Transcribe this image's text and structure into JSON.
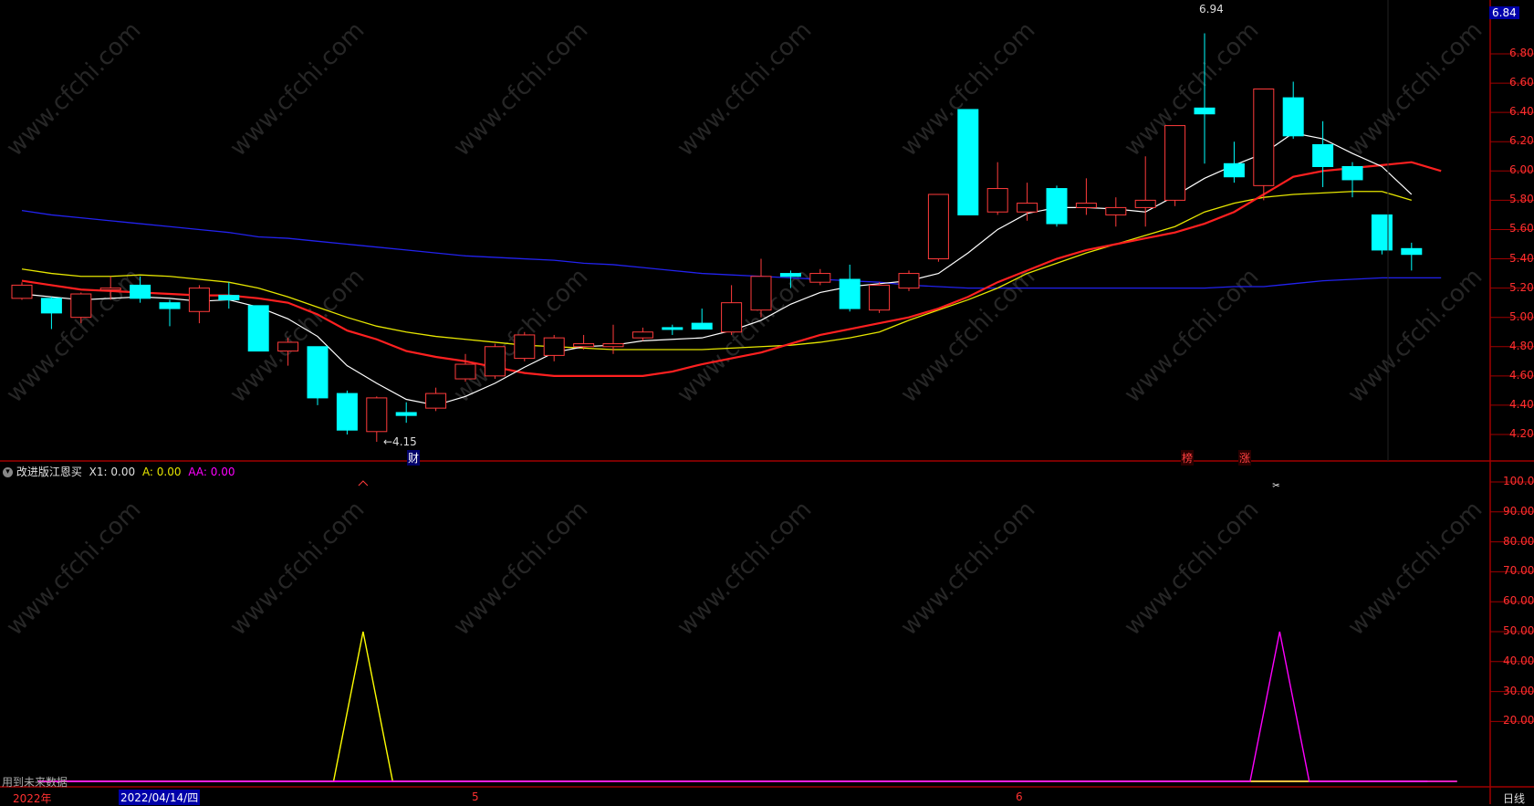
{
  "colors": {
    "up": "#ff3b3b",
    "down": "#00ffff",
    "ma5": "#ffffff",
    "ma10": "#ff2020",
    "ma20": "#e6e600",
    "ma60": "#2222ee",
    "axis": "#a00000",
    "grid": "#5a0000",
    "ind_x1": "#ffff00",
    "ind_aa": "#ff00ff",
    "price_box": "#0000aa"
  },
  "price_axis": {
    "current_price": "6.84",
    "ticks": [
      "6.80",
      "6.60",
      "6.40",
      "6.20",
      "6.00",
      "5.80",
      "5.60",
      "5.40",
      "5.20",
      "5.00",
      "4.80",
      "4.60",
      "4.40",
      "4.20"
    ]
  },
  "chart_data": [
    {
      "type": "candlestick",
      "title": "",
      "ylim": [
        4.1,
        6.9
      ],
      "candles": [
        {
          "o": 5.13,
          "c": 5.22,
          "h": 5.24,
          "l": 5.12
        },
        {
          "o": 5.13,
          "c": 5.03,
          "h": 5.14,
          "l": 4.92
        },
        {
          "o": 5.0,
          "c": 5.16,
          "h": 5.17,
          "l": 4.96
        },
        {
          "o": 5.2,
          "c": 5.2,
          "h": 5.28,
          "l": 5.12
        },
        {
          "o": 5.22,
          "c": 5.13,
          "h": 5.28,
          "l": 5.1
        },
        {
          "o": 5.1,
          "c": 5.06,
          "h": 5.12,
          "l": 4.94
        },
        {
          "o": 5.04,
          "c": 5.2,
          "h": 5.22,
          "l": 4.96
        },
        {
          "o": 5.15,
          "c": 5.12,
          "h": 5.24,
          "l": 5.06
        },
        {
          "o": 5.08,
          "c": 4.77,
          "h": 5.08,
          "l": 4.77
        },
        {
          "o": 4.77,
          "c": 4.83,
          "h": 4.86,
          "l": 4.67
        },
        {
          "o": 4.8,
          "c": 4.45,
          "h": 4.8,
          "l": 4.4
        },
        {
          "o": 4.48,
          "c": 4.23,
          "h": 4.5,
          "l": 4.2
        },
        {
          "o": 4.22,
          "c": 4.45,
          "h": 4.46,
          "l": 4.15
        },
        {
          "o": 4.35,
          "c": 4.33,
          "h": 4.42,
          "l": 4.28
        },
        {
          "o": 4.38,
          "c": 4.48,
          "h": 4.52,
          "l": 4.36
        },
        {
          "o": 4.58,
          "c": 4.68,
          "h": 4.75,
          "l": 4.56
        },
        {
          "o": 4.6,
          "c": 4.8,
          "h": 4.82,
          "l": 4.58
        },
        {
          "o": 4.72,
          "c": 4.88,
          "h": 4.9,
          "l": 4.7
        },
        {
          "o": 4.74,
          "c": 4.86,
          "h": 4.88,
          "l": 4.7
        },
        {
          "o": 4.8,
          "c": 4.82,
          "h": 4.88,
          "l": 4.78
        },
        {
          "o": 4.8,
          "c": 4.82,
          "h": 4.95,
          "l": 4.75
        },
        {
          "o": 4.86,
          "c": 4.9,
          "h": 4.93,
          "l": 4.84
        },
        {
          "o": 4.93,
          "c": 4.92,
          "h": 4.95,
          "l": 4.88
        },
        {
          "o": 4.96,
          "c": 4.92,
          "h": 5.06,
          "l": 4.92
        },
        {
          "o": 4.9,
          "c": 5.1,
          "h": 5.22,
          "l": 4.88
        },
        {
          "o": 5.05,
          "c": 5.28,
          "h": 5.4,
          "l": 5.0
        },
        {
          "o": 5.3,
          "c": 5.28,
          "h": 5.32,
          "l": 5.2
        },
        {
          "o": 5.24,
          "c": 5.3,
          "h": 5.33,
          "l": 5.22
        },
        {
          "o": 5.26,
          "c": 5.06,
          "h": 5.36,
          "l": 5.04
        },
        {
          "o": 5.05,
          "c": 5.22,
          "h": 5.24,
          "l": 5.03
        },
        {
          "o": 5.2,
          "c": 5.3,
          "h": 5.32,
          "l": 5.18
        },
        {
          "o": 5.4,
          "c": 5.84,
          "h": 5.84,
          "l": 5.38
        },
        {
          "o": 6.42,
          "c": 5.7,
          "h": 6.42,
          "l": 5.7
        },
        {
          "o": 5.72,
          "c": 5.88,
          "h": 6.06,
          "l": 5.7
        },
        {
          "o": 5.72,
          "c": 5.78,
          "h": 5.92,
          "l": 5.66
        },
        {
          "o": 5.88,
          "c": 5.64,
          "h": 5.9,
          "l": 5.62
        },
        {
          "o": 5.75,
          "c": 5.78,
          "h": 5.95,
          "l": 5.7
        },
        {
          "o": 5.7,
          "c": 5.75,
          "h": 5.82,
          "l": 5.62
        },
        {
          "o": 5.75,
          "c": 5.8,
          "h": 6.1,
          "l": 5.62
        },
        {
          "o": 5.8,
          "c": 6.31,
          "h": 6.31,
          "l": 5.76
        },
        {
          "o": 6.43,
          "c": 6.39,
          "h": 6.94,
          "l": 6.05
        },
        {
          "o": 6.05,
          "c": 5.96,
          "h": 6.2,
          "l": 5.92
        },
        {
          "o": 5.9,
          "c": 6.56,
          "h": 6.56,
          "l": 5.8
        },
        {
          "o": 6.5,
          "c": 6.24,
          "h": 6.61,
          "l": 6.22
        },
        {
          "o": 6.18,
          "c": 6.03,
          "h": 6.34,
          "l": 5.89
        },
        {
          "o": 6.03,
          "c": 5.94,
          "h": 6.06,
          "l": 5.82
        },
        {
          "o": 5.7,
          "c": 5.46,
          "h": 5.7,
          "l": 5.43
        },
        {
          "o": 5.47,
          "c": 5.43,
          "h": 5.51,
          "l": 5.32
        }
      ],
      "ma5": [
        5.16,
        5.14,
        5.12,
        5.13,
        5.14,
        5.13,
        5.11,
        5.12,
        5.07,
        4.99,
        4.87,
        4.67,
        4.55,
        4.44,
        4.4,
        4.46,
        4.55,
        4.66,
        4.76,
        4.8,
        4.81,
        4.84,
        4.85,
        4.86,
        4.91,
        4.98,
        5.09,
        5.17,
        5.21,
        5.23,
        5.25,
        5.3,
        5.44,
        5.6,
        5.71,
        5.75,
        5.75,
        5.74,
        5.72,
        5.83,
        5.95,
        6.04,
        6.12,
        6.26,
        6.22,
        6.12,
        6.03,
        5.84
      ],
      "ma10": [
        5.25,
        5.22,
        5.19,
        5.18,
        5.17,
        5.16,
        5.15,
        5.15,
        5.13,
        5.1,
        5.02,
        4.91,
        4.85,
        4.77,
        4.73,
        4.7,
        4.66,
        4.62,
        4.6,
        4.6,
        4.6,
        4.6,
        4.63,
        4.68,
        4.72,
        4.76,
        4.82,
        4.88,
        4.92,
        4.96,
        5.0,
        5.06,
        5.14,
        5.24,
        5.32,
        5.4,
        5.46,
        5.5,
        5.54,
        5.58,
        5.64,
        5.72,
        5.84,
        5.96,
        6.0,
        6.02,
        6.04,
        6.06,
        6.0
      ],
      "ma20": [
        5.33,
        5.3,
        5.28,
        5.28,
        5.29,
        5.28,
        5.26,
        5.24,
        5.2,
        5.14,
        5.07,
        5.0,
        4.94,
        4.9,
        4.87,
        4.85,
        4.83,
        4.81,
        4.8,
        4.79,
        4.78,
        4.78,
        4.78,
        4.78,
        4.79,
        4.8,
        4.81,
        4.83,
        4.86,
        4.9,
        4.98,
        5.05,
        5.12,
        5.2,
        5.3,
        5.37,
        5.44,
        5.5,
        5.56,
        5.62,
        5.72,
        5.78,
        5.82,
        5.84,
        5.85,
        5.86,
        5.86,
        5.8
      ],
      "ma60": [
        5.73,
        5.7,
        5.68,
        5.66,
        5.64,
        5.62,
        5.6,
        5.58,
        5.55,
        5.54,
        5.52,
        5.5,
        5.48,
        5.46,
        5.44,
        5.42,
        5.41,
        5.4,
        5.39,
        5.37,
        5.36,
        5.34,
        5.32,
        5.3,
        5.29,
        5.28,
        5.27,
        5.26,
        5.25,
        5.24,
        5.22,
        5.21,
        5.2,
        5.2,
        5.2,
        5.2,
        5.2,
        5.2,
        5.2,
        5.2,
        5.2,
        5.21,
        5.21,
        5.23,
        5.25,
        5.26,
        5.27,
        5.27,
        5.27
      ]
    },
    {
      "type": "line",
      "title": "改进版江恩买",
      "ylim": [
        0,
        100
      ],
      "series": [
        {
          "name": "X1",
          "values": [
            0,
            0,
            0,
            0,
            0,
            0,
            0,
            0,
            0,
            0,
            0,
            50,
            0,
            0,
            0,
            0,
            0,
            0,
            0,
            0,
            0,
            0,
            0,
            0,
            0,
            0,
            0,
            0,
            0,
            0,
            0,
            0,
            0,
            0,
            0,
            0,
            0,
            0,
            0,
            0,
            0,
            0,
            0,
            0,
            0,
            0,
            0,
            0,
            0
          ]
        },
        {
          "name": "A",
          "values": [
            0,
            0,
            0,
            0,
            0,
            0,
            0,
            0,
            0,
            0,
            0,
            0,
            0,
            0,
            0,
            0,
            0,
            0,
            0,
            0,
            0,
            0,
            0,
            0,
            0,
            0,
            0,
            0,
            0,
            0,
            0,
            0,
            0,
            0,
            0,
            0,
            0,
            0,
            0,
            0,
            0,
            0,
            0,
            0,
            0,
            0,
            0,
            0,
            0
          ]
        },
        {
          "name": "AA",
          "values": [
            0,
            0,
            0,
            0,
            0,
            0,
            0,
            0,
            0,
            0,
            0,
            0,
            0,
            0,
            0,
            0,
            0,
            0,
            0,
            0,
            0,
            0,
            0,
            0,
            0,
            0,
            0,
            0,
            0,
            0,
            0,
            0,
            0,
            0,
            0,
            0,
            0,
            0,
            0,
            0,
            0,
            0,
            50,
            0,
            0,
            0,
            0,
            0,
            0
          ]
        }
      ]
    }
  ],
  "annotations": {
    "low_label": "←4.15",
    "high_label": "6.94",
    "tag_cai": "财",
    "tag_bang": "榜",
    "tag_zhang": "涨"
  },
  "indicator": {
    "name": "改进版江恩买",
    "x1_label": "X1: 0.00",
    "a_label": "A: 0.00",
    "aa_label": "AA: 0.00",
    "ticks": [
      "100.00",
      "90.00",
      "80.00",
      "70.00",
      "60.00",
      "50.00",
      "40.00",
      "30.00",
      "20.00"
    ],
    "future_data_note": "用到未来数据"
  },
  "date_axis": {
    "year": "2022年",
    "selected_date": "2022/04/14/四",
    "month5": "5",
    "month6": "6",
    "period": "日线"
  },
  "watermark": "www.cfchi.com"
}
